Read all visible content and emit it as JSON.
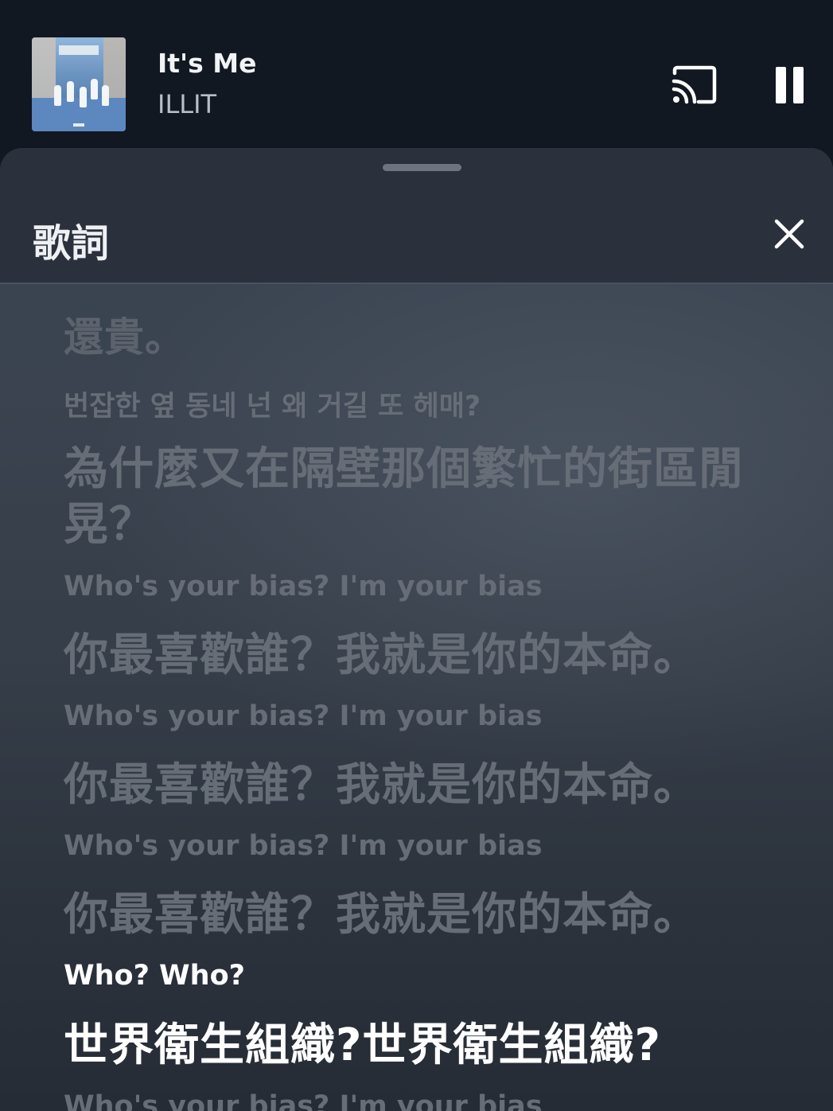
{
  "now_playing": {
    "title": "It's Me",
    "artist": "ILLIT",
    "cast_icon": "cast-icon",
    "pause_icon": "pause-icon"
  },
  "lyrics_sheet": {
    "title": "歌詞",
    "close_icon": "close-icon",
    "lines": [
      {
        "translation": "還貴。"
      },
      {
        "original": "번잡한 옆 동네 넌 왜 거길 또 헤매?",
        "translation_1": "為什麼又在隔壁那個繁忙的街區閒",
        "translation_2": "晃？"
      },
      {
        "original": "Who's your bias? I'm your bias",
        "translation": "你最喜歡誰？我就是你的本命。"
      },
      {
        "original": "Who's your bias? I'm your bias",
        "translation": "你最喜歡誰？我就是你的本命。"
      },
      {
        "original": "Who's your bias? I'm your bias",
        "translation": "你最喜歡誰？我就是你的本命。"
      },
      {
        "original": "Who? Who?",
        "translation": "世界衛生組織?世界衛生組織?",
        "active": true
      },
      {
        "original": "Who's your bias? I'm your bias"
      }
    ]
  }
}
